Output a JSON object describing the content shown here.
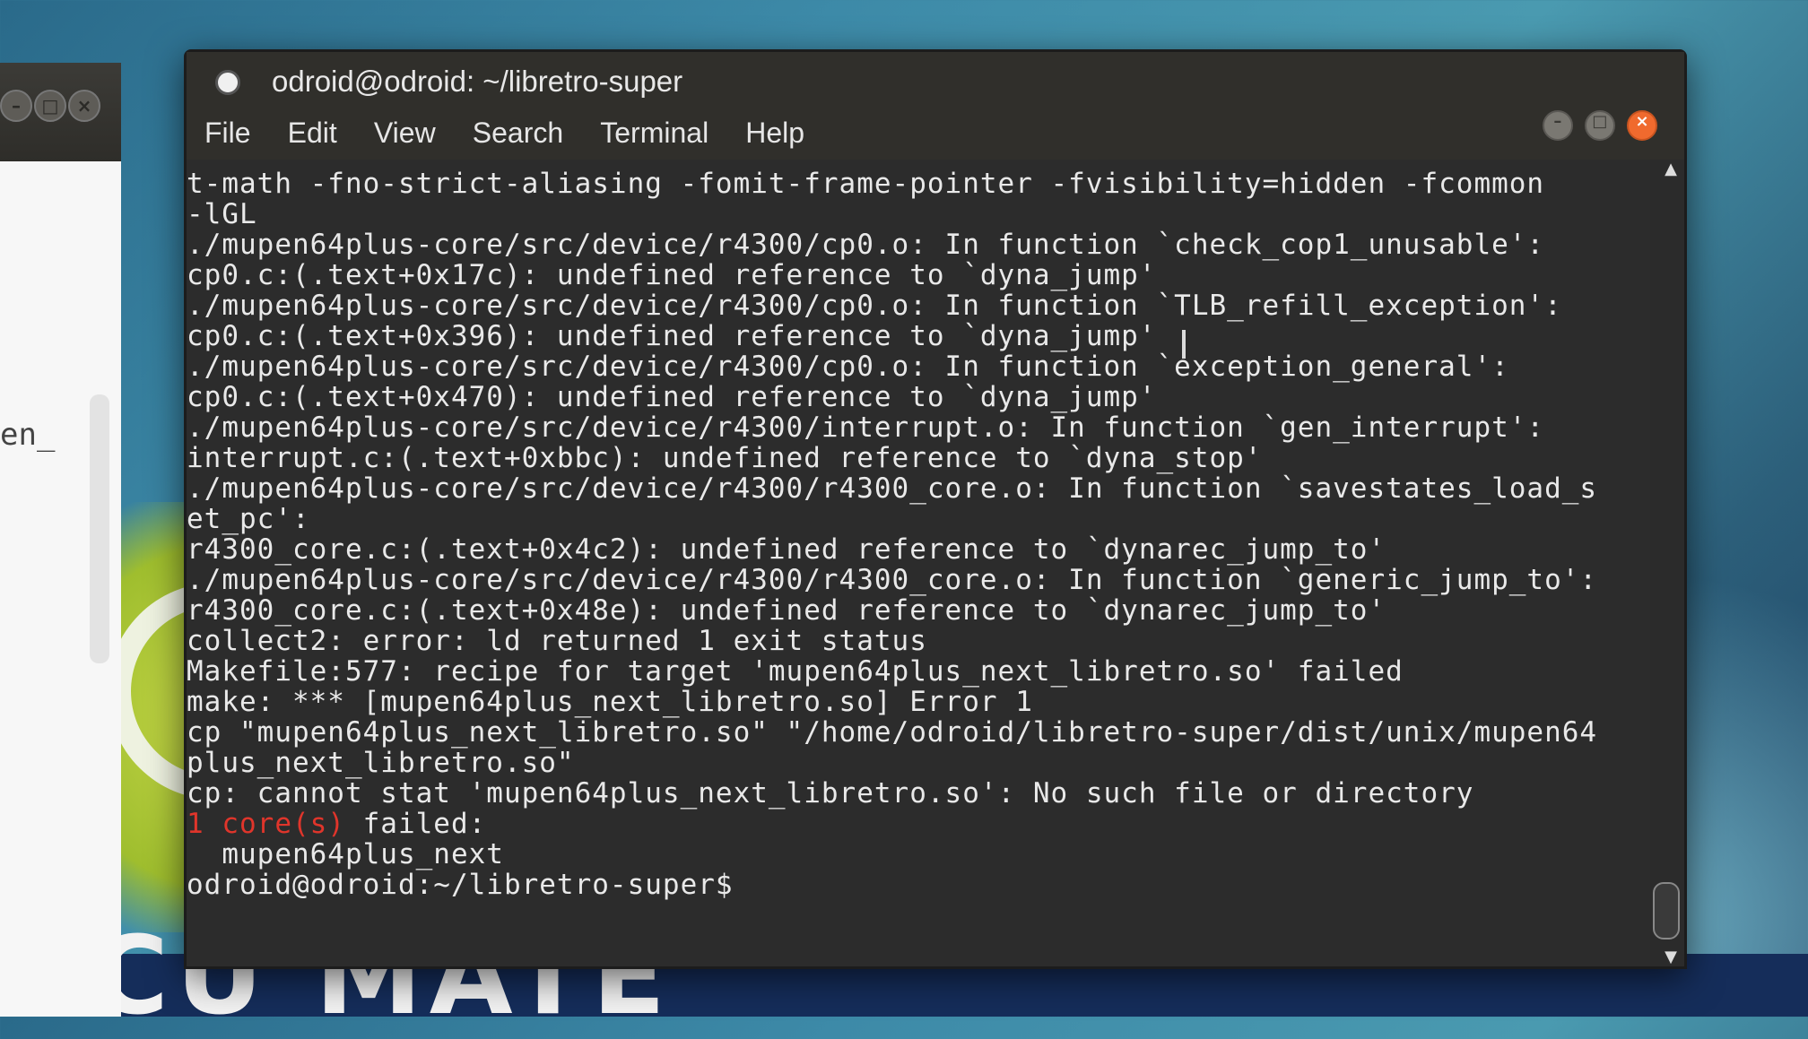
{
  "left_window": {
    "visible_text": "en_"
  },
  "background": {
    "brand_text": "CU MATE"
  },
  "terminal": {
    "title": "odroid@odroid: ~/libretro-super",
    "menu": [
      "File",
      "Edit",
      "View",
      "Search",
      "Terminal",
      "Help"
    ],
    "lines": [
      "t-math -fno-strict-aliasing -fomit-frame-pointer -fvisibility=hidden -fcommon",
      "-lGL",
      "./mupen64plus-core/src/device/r4300/cp0.o: In function `check_cop1_unusable':",
      "cp0.c:(.text+0x17c): undefined reference to `dyna_jump'",
      "./mupen64plus-core/src/device/r4300/cp0.o: In function `TLB_refill_exception':",
      "cp0.c:(.text+0x396): undefined reference to `dyna_jump'",
      "./mupen64plus-core/src/device/r4300/cp0.o: In function `exception_general':",
      "cp0.c:(.text+0x470): undefined reference to `dyna_jump'",
      "./mupen64plus-core/src/device/r4300/interrupt.o: In function `gen_interrupt':",
      "interrupt.c:(.text+0xbbc): undefined reference to `dyna_stop'",
      "./mupen64plus-core/src/device/r4300/r4300_core.o: In function `savestates_load_s",
      "et_pc':",
      "r4300_core.c:(.text+0x4c2): undefined reference to `dynarec_jump_to'",
      "./mupen64plus-core/src/device/r4300/r4300_core.o: In function `generic_jump_to':",
      "r4300_core.c:(.text+0x48e): undefined reference to `dynarec_jump_to'",
      "collect2: error: ld returned 1 exit status",
      "Makefile:577: recipe for target 'mupen64plus_next_libretro.so' failed",
      "make: *** [mupen64plus_next_libretro.so] Error 1",
      "cp \"mupen64plus_next_libretro.so\" \"/home/odroid/libretro-super/dist/unix/mupen64",
      "plus_next_libretro.so\"",
      "cp: cannot stat 'mupen64plus_next_libretro.so': No such file or directory"
    ],
    "fail_count": "1 core(s)",
    "fail_suffix": " failed:",
    "failed_core": "  mupen64plus_next",
    "prompt": "odroid@odroid:~/libretro-super$"
  },
  "colors": {
    "error_red": "#e0352b",
    "close_button": "#f06a2e"
  }
}
